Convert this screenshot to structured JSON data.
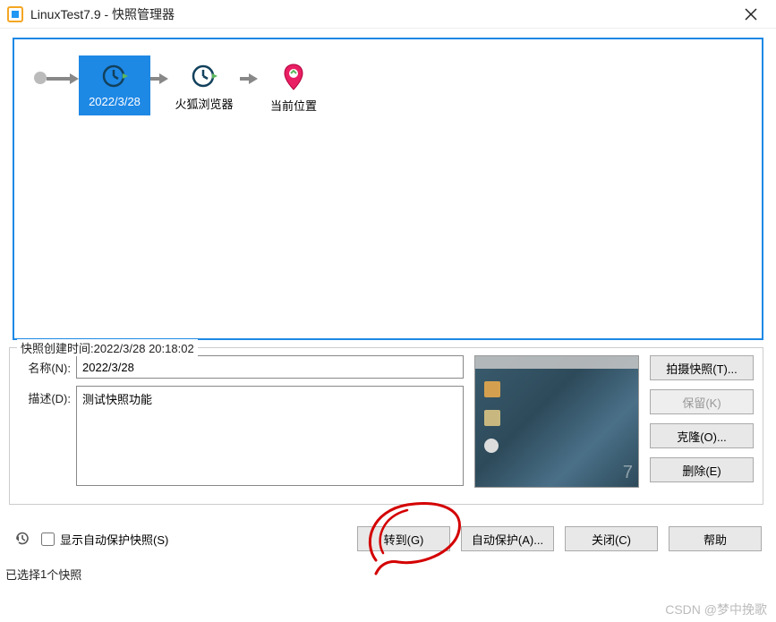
{
  "window": {
    "title": "LinuxTest7.9 - 快照管理器"
  },
  "timeline": {
    "snapshot1": {
      "label": "2022/3/28"
    },
    "snapshot2": {
      "label": "火狐浏览器"
    },
    "current": {
      "label": "当前位置"
    }
  },
  "details": {
    "legend_prefix": "快照创建时间:",
    "created_time": "2022/3/28 20:18:02",
    "name_label": "名称(N):",
    "name_value": "2022/3/28",
    "desc_label": "描述(D):",
    "desc_value": "测试快照功能"
  },
  "buttons": {
    "take_snapshot": "拍摄快照(T)...",
    "keep": "保留(K)",
    "clone": "克隆(O)...",
    "delete": "删除(E)",
    "goto": "转到(G)",
    "auto_protect": "自动保护(A)...",
    "close": "关闭(C)",
    "help": "帮助"
  },
  "checkbox": {
    "show_auto_protect": "显示自动保护快照(S)"
  },
  "status": {
    "selected_prefix": "已选择 ",
    "selected_count": "1",
    "selected_suffix": " 个快照"
  },
  "watermark": "CSDN @梦中挽歌"
}
